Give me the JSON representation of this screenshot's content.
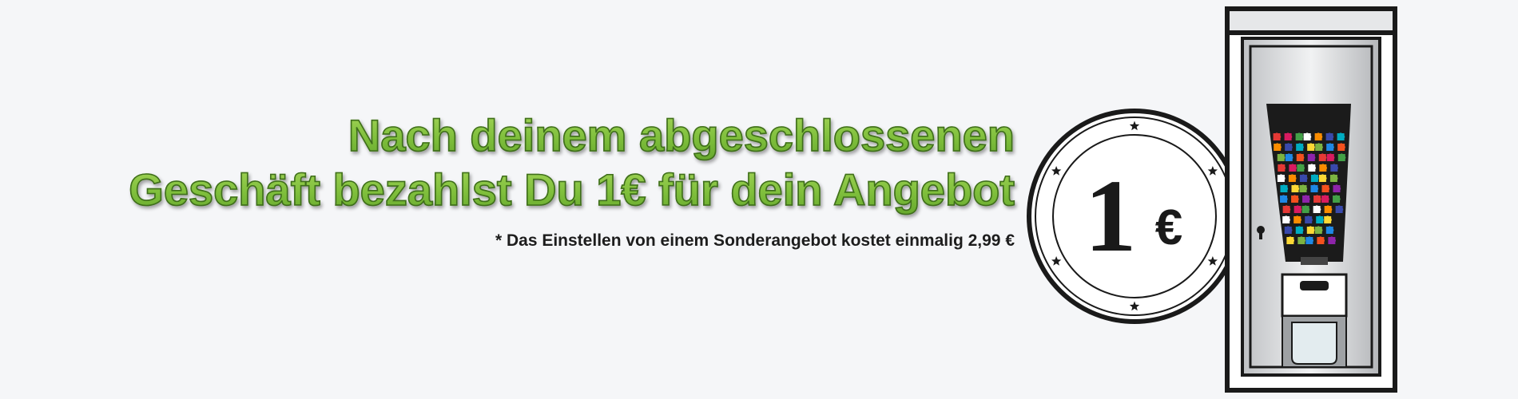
{
  "banner": {
    "headline_line1": "Nach deinem abgeschlossenen",
    "headline_line2": "Geschäft bezahlst Du 1€ für dein Angebot",
    "footnote": "* Das Einstellen von einem Sonderangebot kostet einmalig 2,99 €"
  },
  "coin": {
    "value": "1",
    "currency_symbol": "€",
    "star_icon": "star-icon"
  },
  "machine": {
    "icon": "gumball-vending-machine-icon",
    "contents_icon": "puzzle-piece-icon"
  },
  "colors": {
    "background": "#f5f6f8",
    "headline_green_light": "#a6d65a",
    "headline_green_dark": "#63a52b",
    "headline_outline": "#3f6e1c",
    "footnote_text": "#1d1d1d",
    "coin_ink": "#1a1a1a",
    "machine_frame": "#1a1a1a"
  }
}
